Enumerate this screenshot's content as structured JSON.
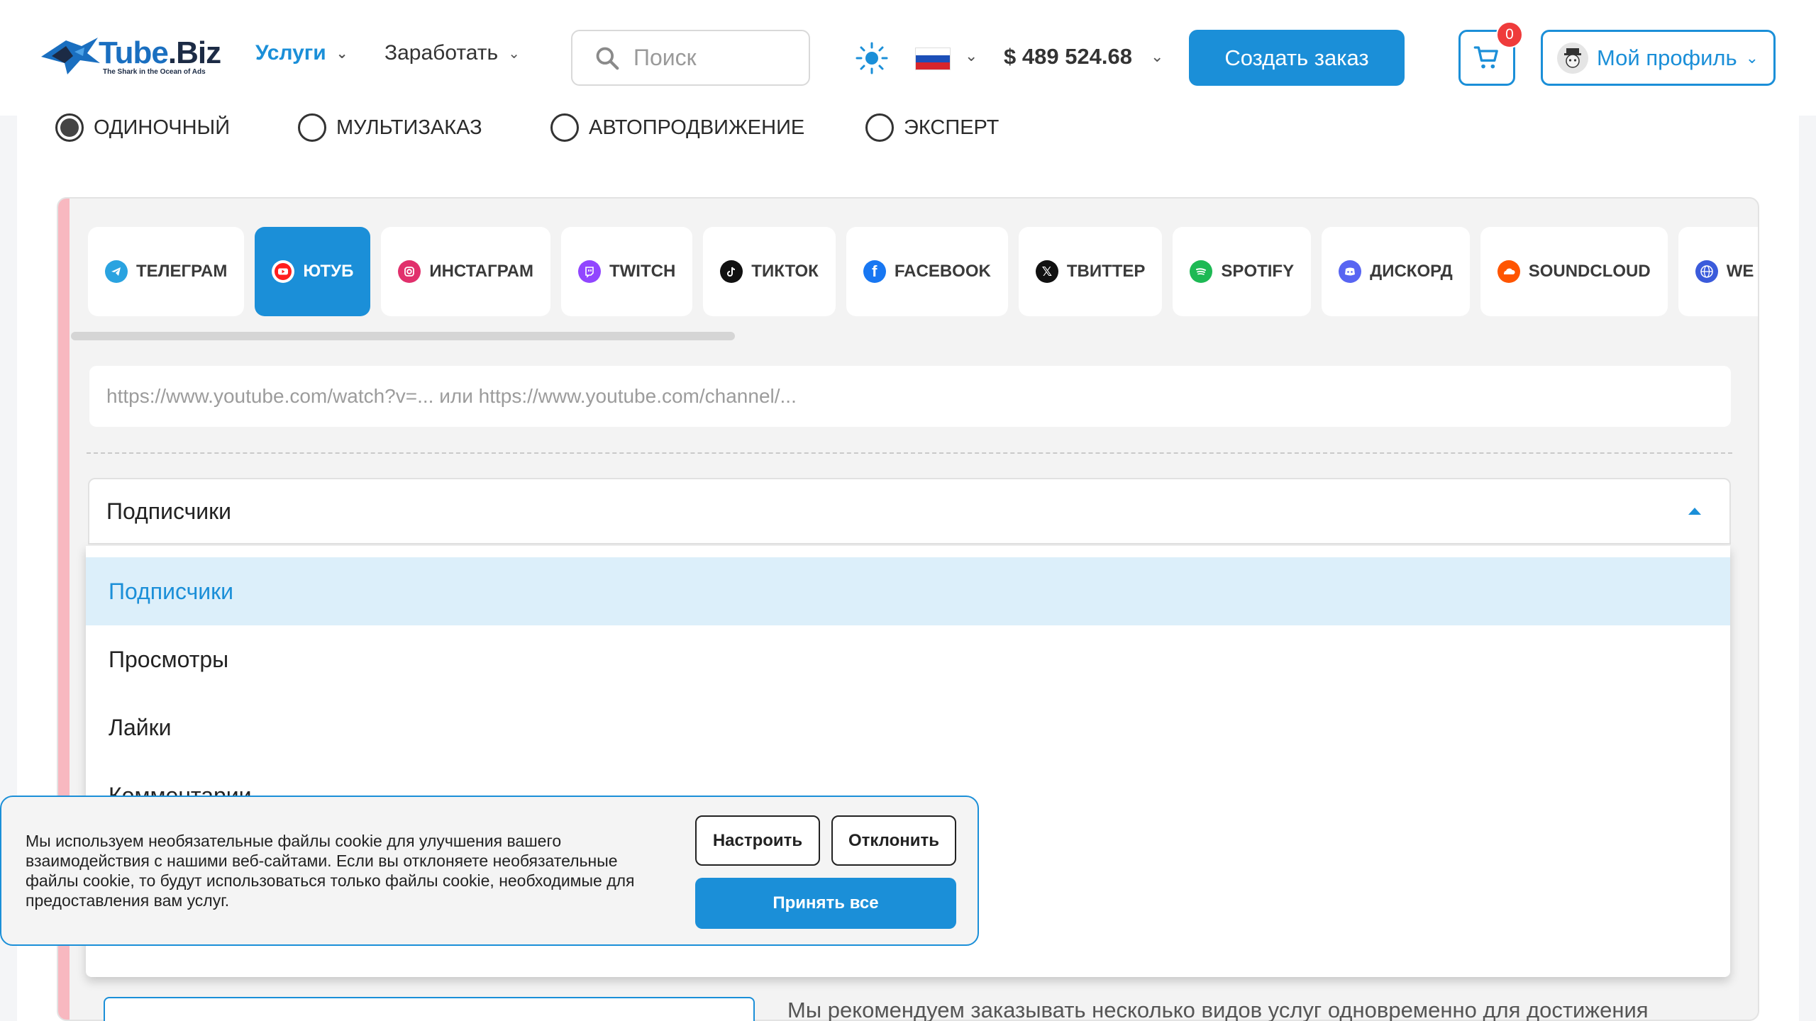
{
  "header": {
    "logo_main": "Tube",
    "logo_dot": ".Biz",
    "logo_sub": "The Shark in the Ocean of Ads",
    "nav": [
      {
        "label": "Услуги",
        "icon": "chevron-down-icon"
      },
      {
        "label": "Заработать",
        "icon": "chevron-down-icon"
      }
    ],
    "search_placeholder": "Поиск",
    "balance": "$ 489 524.68",
    "create_order": "Создать заказ",
    "cart_count": "0",
    "profile": "Мой профиль"
  },
  "modes": [
    {
      "label": "ОДИНОЧНЫЙ",
      "checked": true
    },
    {
      "label": "МУЛЬТИЗАКАЗ",
      "checked": false
    },
    {
      "label": "АВТОПРОДВИЖЕНИЕ",
      "checked": false
    },
    {
      "label": "ЭКСПЕРТ",
      "checked": false
    }
  ],
  "tabs": [
    {
      "label": "ТЕЛЕГРАМ",
      "icon": "telegram-icon",
      "color": "#2aa3e0",
      "active": false
    },
    {
      "label": "ЮТУБ",
      "icon": "youtube-icon",
      "color": "#ff0000",
      "active": true
    },
    {
      "label": "ИНСТАГРАМ",
      "icon": "instagram-icon",
      "color": "#e1306c",
      "active": false
    },
    {
      "label": "TWITCH",
      "icon": "twitch-icon",
      "color": "#9146ff",
      "active": false
    },
    {
      "label": "ТИКТОК",
      "icon": "tiktok-icon",
      "color": "#111111",
      "active": false
    },
    {
      "label": "FACEBOOK",
      "icon": "facebook-icon",
      "color": "#1877f2",
      "active": false
    },
    {
      "label": "ТВИТТЕР",
      "icon": "x-icon",
      "color": "#111111",
      "active": false
    },
    {
      "label": "SPOTIFY",
      "icon": "spotify-icon",
      "color": "#1db954",
      "active": false
    },
    {
      "label": "ДИСКОРД",
      "icon": "discord-icon",
      "color": "#5865f2",
      "active": false
    },
    {
      "label": "SOUNDCLOUD",
      "icon": "soundcloud-icon",
      "color": "#ff5500",
      "active": false
    },
    {
      "label": "WE",
      "icon": "web-icon",
      "color": "#3b5bdb",
      "active": false
    }
  ],
  "url_placeholder": "https://www.youtube.com/watch?v=... или https://www.youtube.com/channel/...",
  "select": {
    "value": "Подписчики",
    "options": [
      "Подписчики",
      "Просмотры",
      "Лайки",
      "Комментарии"
    ]
  },
  "bottom_note": "Мы рекомендуем заказывать несколько видов услуг одновременно для достижения",
  "cookie": {
    "text": "Мы используем необязательные файлы cookie для улучшения вашего взаимодействия с нашими веб-сайтами. Если вы отклоняете необязательные файлы cookie, то будут использоваться только файлы cookie, необходимые для предоставления вам услуг.",
    "customize": "Настроить",
    "decline": "Отклонить",
    "accept": "Принять все"
  },
  "colors": {
    "accent": "#1b8fd8",
    "badge": "#ef3b3b",
    "stripe": "#f8b8c0"
  }
}
